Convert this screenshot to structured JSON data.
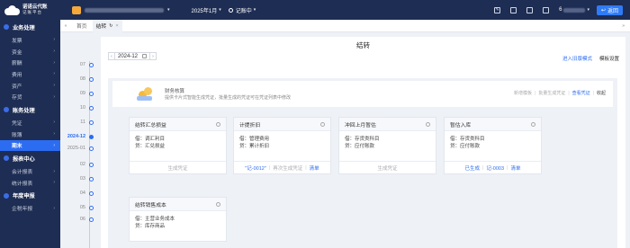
{
  "header": {
    "logo_name": "诺诺云代账",
    "logo_sub": "记账平台",
    "period": "2025年1月",
    "status": "记账中",
    "user": "6",
    "back_label": "返回"
  },
  "tabs": [
    {
      "label": "首页"
    },
    {
      "label": "结转"
    }
  ],
  "sidebar": {
    "sections": [
      {
        "title": "业务处理",
        "items": [
          "发票",
          "资金",
          "薪酬",
          "费用",
          "资产",
          "存货"
        ]
      },
      {
        "title": "账务处理",
        "items": [
          "凭证",
          "账簿",
          "期末"
        ]
      },
      {
        "title": "报表中心",
        "items": [
          "会计报表",
          "统计报表"
        ]
      },
      {
        "title": "年度申报",
        "items": [
          "企税年报"
        ]
      }
    ],
    "active_item": "期末"
  },
  "timeline": [
    "07",
    "08",
    "09",
    "10",
    "11",
    "2024-12",
    "2025-01",
    "02",
    "03",
    "04",
    "05",
    "06"
  ],
  "timeline_current": "2024-12",
  "page": {
    "title": "结转",
    "period_value": "2024-12",
    "link_entry_mode": "进入旧版模式",
    "link_template": "模板设置"
  },
  "banner": {
    "title": "财务核算",
    "desc": "提供卡片式智能生成凭证，批量生成的凭证可在凭证列表中修改",
    "actions": [
      "新增模板",
      "批量生成凭证",
      "查看凭证",
      "收起"
    ]
  },
  "cards": [
    {
      "title": "结转汇总损益",
      "debit": "借：调汇利目",
      "credit": "贷：汇兑损益",
      "footer": [
        "生成凭证"
      ]
    },
    {
      "title": "计提折旧",
      "debit": "借：管理费用",
      "credit": "贷：累计折旧",
      "footer": [
        "记-0012",
        "再次生成凭证",
        "清单"
      ]
    },
    {
      "title": "冲回上月暂估",
      "debit": "借：存货类科目",
      "credit": "贷：应付账款",
      "footer": [
        "生成凭证"
      ]
    },
    {
      "title": "暂估入库",
      "debit": "借：存货类科目",
      "credit": "贷：应付账款",
      "footer": [
        "已生成",
        "记-0003",
        "清单"
      ]
    },
    {
      "title": "结转销售成本",
      "debit": "借：主营业务成本",
      "credit": "贷：库存商品",
      "footer": []
    }
  ],
  "colors": {
    "topbar": "#1e2d53",
    "accent": "#2c6cf1"
  }
}
